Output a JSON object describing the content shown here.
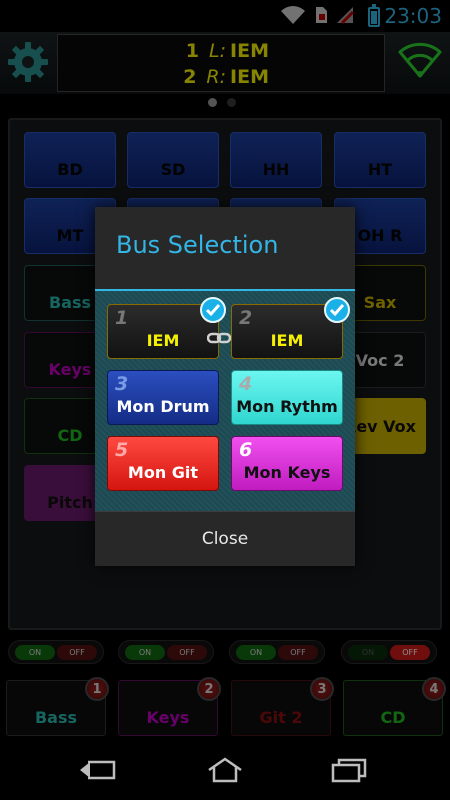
{
  "status": {
    "clock": "23:03"
  },
  "header": {
    "bus_left_num": "1",
    "bus_left_side": "L:",
    "bus_left_name": "IEM",
    "bus_right_num": "2",
    "bus_right_side": "R:",
    "bus_right_name": "IEM"
  },
  "channels": {
    "bd": "BD",
    "sd": "SD",
    "hh": "HH",
    "ht": "HT",
    "mt": "MT",
    "ohr": "OH R",
    "bass": "Bass",
    "sax": "Sax",
    "keys": "Keys",
    "voc2": "Voc 2",
    "cd": "CD",
    "revvox": "Rev Vox",
    "pitch": "Pitch"
  },
  "toggles": [
    {
      "on": "ON",
      "off": "OFF"
    },
    {
      "on": "ON",
      "off": "OFF"
    },
    {
      "on": "ON",
      "off": "OFF"
    },
    {
      "on": "ON",
      "off": "OFF"
    }
  ],
  "mixes": [
    {
      "label": "Bass",
      "num": "1"
    },
    {
      "label": "Keys",
      "num": "2"
    },
    {
      "label": "Git 2",
      "num": "3"
    },
    {
      "label": "CD",
      "num": "4"
    }
  ],
  "dialog": {
    "title": "Bus Selection",
    "buses": [
      {
        "num": "1",
        "label": "IEM"
      },
      {
        "num": "2",
        "label": "IEM"
      },
      {
        "num": "3",
        "label": "Mon Drum"
      },
      {
        "num": "4",
        "label": "Mon Rythm"
      },
      {
        "num": "5",
        "label": "Mon Git"
      },
      {
        "num": "6",
        "label": "Mon Keys"
      }
    ],
    "close": "Close"
  },
  "colors": {
    "accent": "#33b5e5",
    "yellow": "#f5f000"
  },
  "icons": {
    "settings": "gear-icon",
    "wifi": "wifi-icon",
    "back": "back-icon",
    "home": "home-icon",
    "recents": "recents-icon",
    "check": "check-circle-icon",
    "link": "link-icon"
  }
}
